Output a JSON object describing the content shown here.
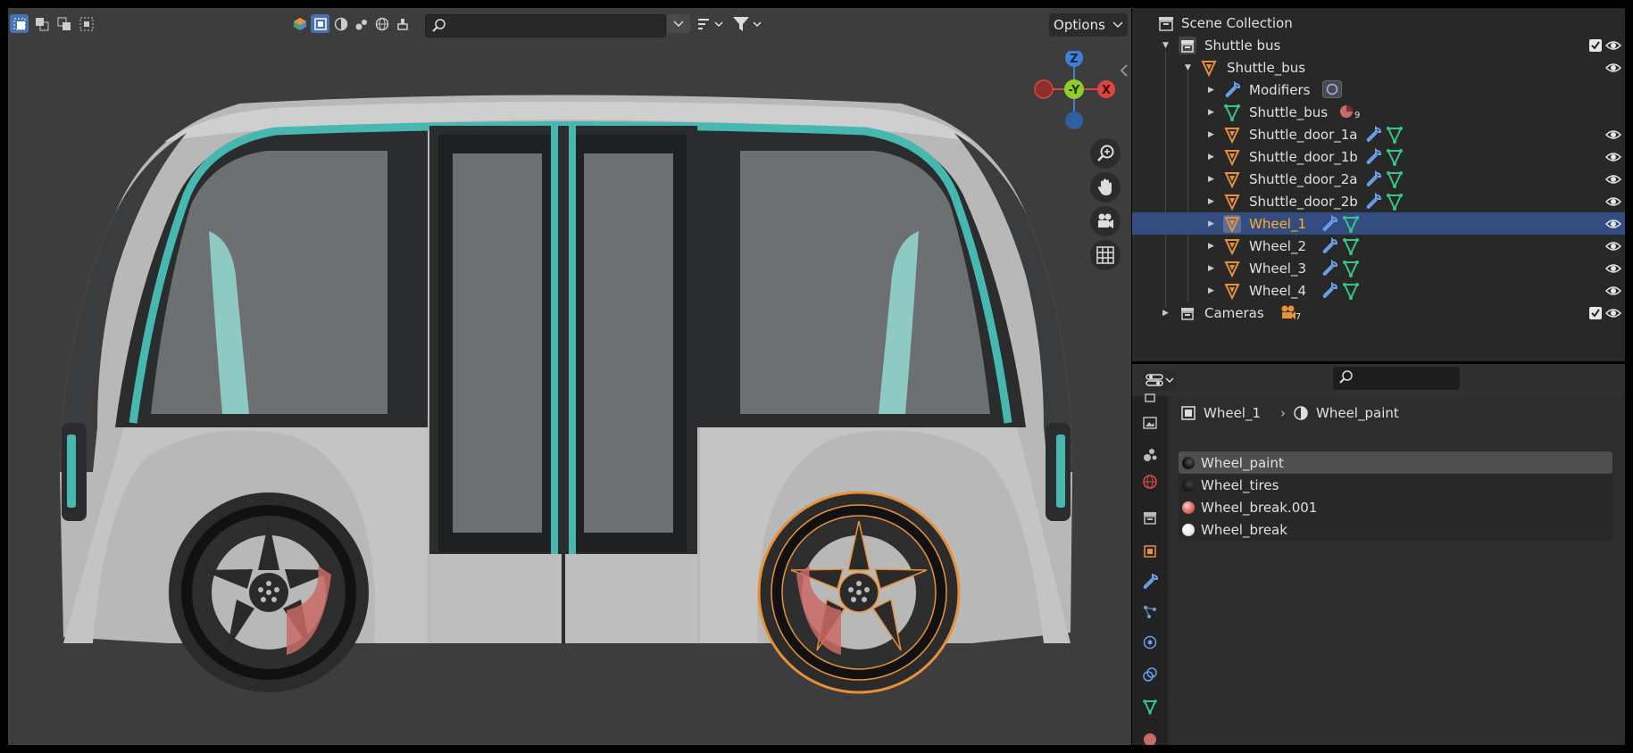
{
  "viewport": {
    "options_label": "Options",
    "gizmo": {
      "z_label": "Z",
      "y_label": "-Y",
      "x_label": "X"
    }
  },
  "outliner": {
    "scene_collection": "Scene Collection",
    "rows": [
      {
        "label": "Shuttle bus",
        "icon": "collection-icon"
      },
      {
        "label": "Shuttle_bus",
        "icon": "object-icon"
      },
      {
        "label": "Modifiers",
        "icon": "wrench-icon"
      },
      {
        "label": "Shuttle_bus",
        "icon": "mesh-data-icon",
        "badge": "9"
      },
      {
        "label": "Shuttle_door_1a",
        "icon": "object-icon"
      },
      {
        "label": "Shuttle_door_1b",
        "icon": "object-icon"
      },
      {
        "label": "Shuttle_door_2a",
        "icon": "object-icon"
      },
      {
        "label": "Shuttle_door_2b",
        "icon": "object-icon"
      },
      {
        "label": "Wheel_1",
        "icon": "object-icon",
        "selected": true
      },
      {
        "label": "Wheel_2",
        "icon": "object-icon"
      },
      {
        "label": "Wheel_3",
        "icon": "object-icon"
      },
      {
        "label": "Wheel_4",
        "icon": "object-icon"
      },
      {
        "label": "Cameras",
        "icon": "collection-icon",
        "badge": "7"
      }
    ]
  },
  "properties": {
    "breadcrumb": {
      "object": "Wheel_1",
      "material": "Wheel_paint"
    },
    "materials": [
      {
        "name": "Wheel_paint",
        "color": "#1a1a1a",
        "active": true
      },
      {
        "name": "Wheel_tires",
        "color": "#222222"
      },
      {
        "name": "Wheel_break.001",
        "color": "#e0706a"
      },
      {
        "name": "Wheel_break",
        "color": "#f2f2f2"
      }
    ]
  },
  "colors": {
    "accent": "#4772b3",
    "selection": "#334d80",
    "object_orange": "#e8913a",
    "mesh_green": "#35c48a",
    "wrench_blue": "#6a9fe8",
    "bus_teal": "#47b8b0"
  }
}
